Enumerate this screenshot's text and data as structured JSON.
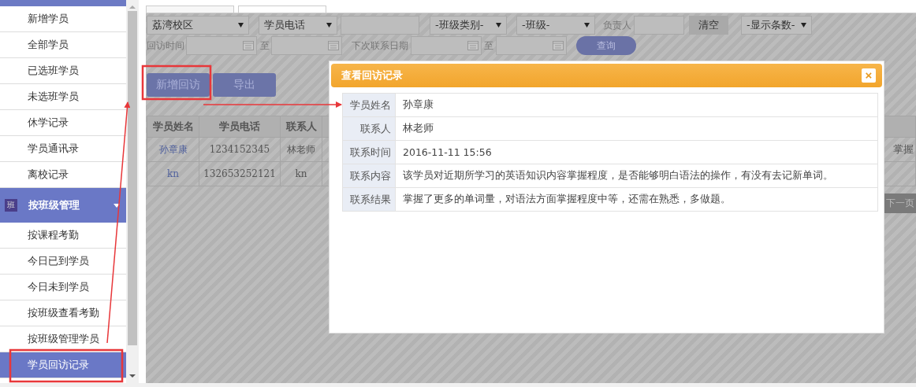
{
  "sidebar": {
    "items": [
      {
        "label": "新增学员",
        "selected": false
      },
      {
        "label": "全部学员",
        "selected": false
      },
      {
        "label": "已选班学员",
        "selected": false
      },
      {
        "label": "未选班学员",
        "selected": false
      },
      {
        "label": "休学记录",
        "selected": false
      },
      {
        "label": "学员通讯录",
        "selected": false
      },
      {
        "label": "离校记录",
        "selected": false
      }
    ],
    "section": {
      "icon_text": "班",
      "label": "按班级管理",
      "expanded": true
    },
    "section_items": [
      {
        "label": "按课程考勤",
        "selected": false
      },
      {
        "label": "今日已到学员",
        "selected": false
      },
      {
        "label": "今日未到学员",
        "selected": false
      },
      {
        "label": "按班级查看考勤",
        "selected": false
      },
      {
        "label": "按班级管理学员",
        "selected": false
      },
      {
        "label": "学员回访记录",
        "selected": true
      }
    ]
  },
  "filters": {
    "row_1": [
      {
        "kind": "select",
        "value": "荔湾校区"
      },
      {
        "kind": "select",
        "value": "学员电话"
      },
      {
        "kind": "input"
      },
      {
        "kind": "select",
        "value": "-班级类别-"
      },
      {
        "kind": "select",
        "value": "-班级-"
      },
      {
        "kind": "label",
        "text": "负责人"
      },
      {
        "kind": "input"
      },
      {
        "kind": "button",
        "text": "清空"
      },
      {
        "kind": "select",
        "value": "-显示条数-"
      }
    ],
    "row_2": [
      {
        "kind": "label",
        "text": "回访时间"
      },
      {
        "kind": "date"
      },
      {
        "kind": "label",
        "text": "至"
      },
      {
        "kind": "date"
      },
      {
        "kind": "label",
        "text": "下次联系日期"
      },
      {
        "kind": "date"
      },
      {
        "kind": "label",
        "text": "至"
      },
      {
        "kind": "date"
      },
      {
        "kind": "pill",
        "text": "查询"
      }
    ]
  },
  "toolbar": {
    "buttons": [
      "新增回访",
      "导出"
    ]
  },
  "table": {
    "columns": [
      "学员姓名",
      "学员电话",
      "联系人"
    ],
    "rows": [
      {
        "cells": [
          "孙章康",
          "1234152345",
          "林老师"
        ],
        "column_last": "掌握"
      },
      {
        "cells": [
          "kn",
          "132653252121",
          "kn"
        ]
      }
    ]
  },
  "pagination": {
    "next": "下一页"
  },
  "dialog": {
    "title": "查看回访记录",
    "close": "×",
    "fields": [
      {
        "label": "学员姓名",
        "value": "孙章康"
      },
      {
        "label": "联系人",
        "value": "林老师"
      },
      {
        "label": "联系时间",
        "value": "2016-11-11 15:56"
      },
      {
        "label": "联系内容",
        "value": "该学员对近期所学习的英语知识内容掌握程度，是否能够明白语法的操作，有没有去记新单词。"
      },
      {
        "label": "联系结果",
        "value": "掌握了更多的单词量，对语法方面掌握程度中等，还需在熟悉，多做题。"
      }
    ]
  }
}
